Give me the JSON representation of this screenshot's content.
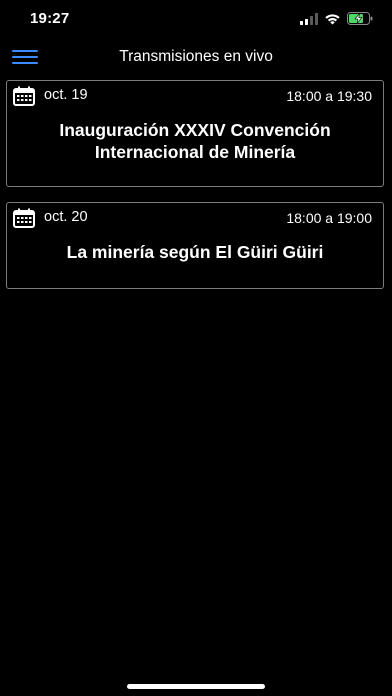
{
  "status_bar": {
    "time": "19:27",
    "icons": [
      "signal-icon",
      "wifi-icon",
      "battery-charging-icon"
    ]
  },
  "nav": {
    "title": "Transmisiones en vivo",
    "menu_icon": "hamburger-menu-icon",
    "accent_color": "#3d8bff"
  },
  "events": [
    {
      "date": "oct. 19",
      "time": "18:00 a 19:30",
      "title_line1": "Inauguración XXXIV Convención",
      "title_line2": "Internacional de Minería",
      "icon": "calendar-icon"
    },
    {
      "date": "oct. 20",
      "time": "18:00 a 19:00",
      "title_line1": "La minería según El Güiri Güiri",
      "icon": "calendar-icon"
    }
  ]
}
